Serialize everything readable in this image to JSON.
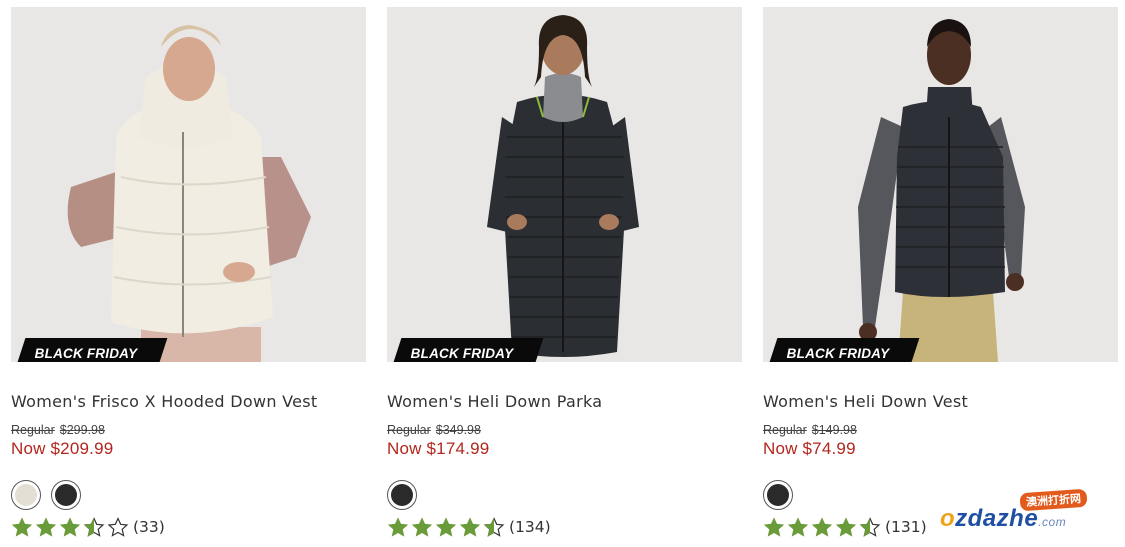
{
  "products": [
    {
      "badge": "BLACK FRIDAY",
      "name": "Women's Frisco X Hooded Down Vest",
      "regular_label": "Regular",
      "regular_price": "$299.98",
      "now_price": "Now $209.99",
      "swatches": [
        {
          "name": "cream",
          "color": "#e4dfd4"
        },
        {
          "name": "black",
          "color": "#2a2a2a"
        }
      ],
      "rating": 3.5,
      "review_count": "(33)",
      "image": "model-cream-hooded-vest"
    },
    {
      "badge": "BLACK FRIDAY",
      "name": "Women's Heli Down Parka",
      "regular_label": "Regular",
      "regular_price": "$349.98",
      "now_price": "Now $174.99",
      "swatches": [
        {
          "name": "black",
          "color": "#2a2a2a"
        }
      ],
      "rating": 4.5,
      "review_count": "(134)",
      "image": "model-black-long-parka"
    },
    {
      "badge": "BLACK FRIDAY",
      "name": "Women's Heli Down Vest",
      "regular_label": "Regular",
      "regular_price": "$149.98",
      "now_price": "Now $74.99",
      "swatches": [
        {
          "name": "black",
          "color": "#2a2a2a"
        }
      ],
      "rating": 4.5,
      "review_count": "(131)",
      "image": "model-black-down-vest"
    }
  ],
  "colors": {
    "star_green": "#6a9b3a",
    "sale_red": "#b3261e",
    "badge_black": "#0a0a0a"
  },
  "watermark": {
    "top_text": "澳洲打折网",
    "brand_prefix": "",
    "brand_o": "o",
    "brand_rest": "zdazhe",
    "brand_suffix": ".com"
  }
}
